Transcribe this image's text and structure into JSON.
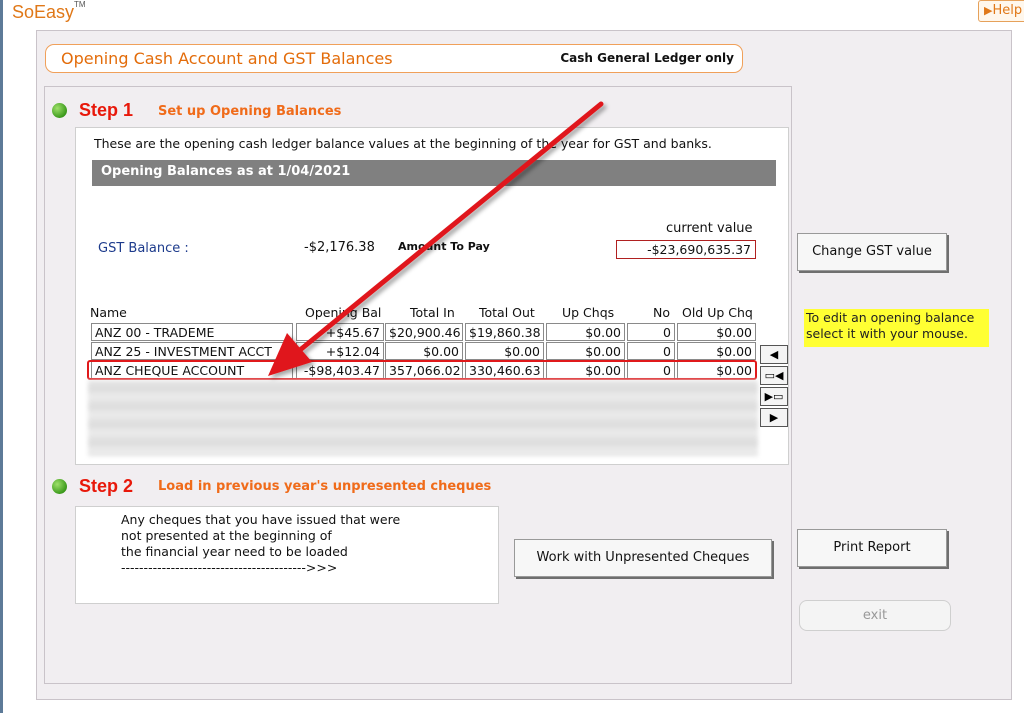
{
  "app": {
    "logo": "SoEasy",
    "tm": "TM",
    "help_label": "Help"
  },
  "header": {
    "title": "Opening Cash Account and GST Balances",
    "note": "Cash General Ledger only"
  },
  "step1": {
    "label": "Step 1",
    "description": "Set up Opening Balances",
    "intro": "These are the opening cash ledger balance values at the beginning of the year for GST and banks.",
    "balances_header": "Opening Balances as at  1/04/2021",
    "current_value_label": "current value",
    "gst_label": "GST Balance :",
    "gst_opening": "-$2,176.38",
    "amount_label": "Amount To Pay",
    "gst_current": "-$23,690,635.37",
    "columns": [
      "Name",
      "Opening Bal",
      "Total In",
      "Total Out",
      "Up Chqs",
      "No",
      "Old Up Chq"
    ],
    "rows": [
      {
        "name": "ANZ 00 - TRADEME",
        "opening": "+$45.67",
        "total_in": "$20,900.46",
        "total_out": "$19,860.38",
        "up_chqs": "$0.00",
        "no": "0",
        "old_up": "$0.00"
      },
      {
        "name": "ANZ 25 - INVESTMENT ACCT",
        "opening": "+$12.04",
        "total_in": "$0.00",
        "total_out": "$0.00",
        "up_chqs": "$0.00",
        "no": "0",
        "old_up": "$0.00"
      },
      {
        "name": "ANZ CHEQUE ACCOUNT",
        "opening": "-$98,403.47",
        "total_in": "357,066.02",
        "total_out": "330,460.63",
        "up_chqs": "$0.00",
        "no": "0",
        "old_up": "$0.00"
      }
    ],
    "nav_icons": [
      "triangle-left",
      "page-left",
      "page-right",
      "triangle-right"
    ],
    "nav_glyphs": [
      "◀",
      "▭◀",
      "▶▭",
      "▶"
    ]
  },
  "sidebar": {
    "change_gst_button": "Change GST value",
    "tip": "To edit an opening balance select it with your mouse.",
    "print_button": "Print Report",
    "exit_button": "exit"
  },
  "step2": {
    "label": "Step 2",
    "description": "Load in previous year's unpresented cheques",
    "text": "Any cheques that you have issued that were\nnot presented at the beginning of\nthe financial year need to be loaded\n----------------------------------------->>>",
    "button": "Work with Unpresented Cheques"
  },
  "colors": {
    "accent": "#e36c0a",
    "step": "#e8180a",
    "annotation": "#e0191b",
    "tip_bg": "#ffff33"
  }
}
